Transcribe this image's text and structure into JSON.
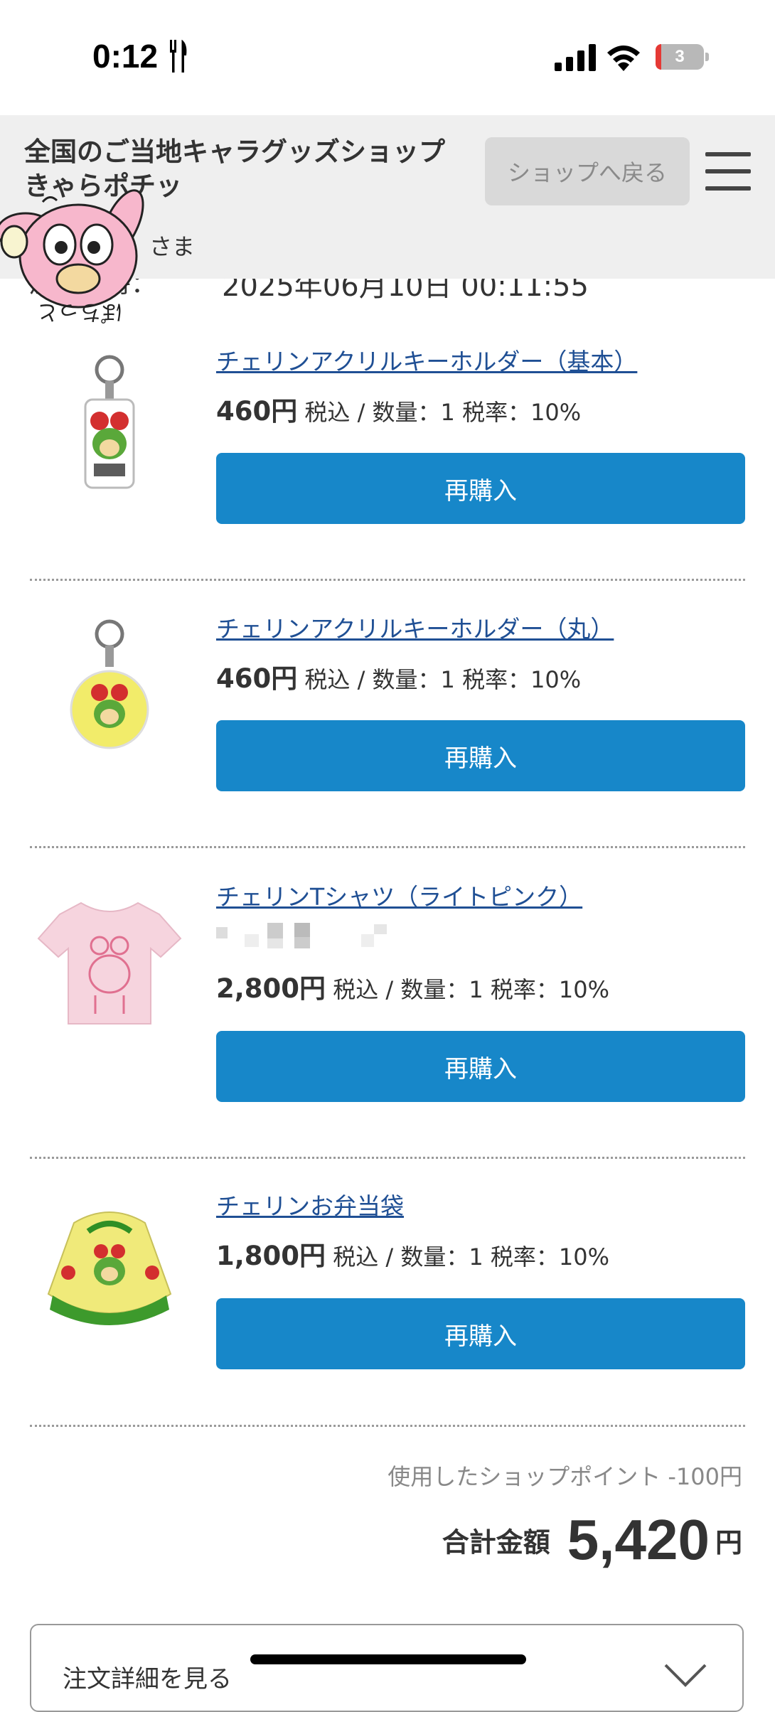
{
  "status_bar": {
    "time": "0:12",
    "battery": "3"
  },
  "header": {
    "shop_title": "全国のご当地キャラグッズショップ　きゃらポチッ",
    "back_button": "ショップへ戻る",
    "greeting": "さま"
  },
  "order": {
    "label": "注文日時：",
    "date": "2025年06月10日 00:11:55"
  },
  "mascot": {
    "caption": "ぽちっと"
  },
  "items": [
    {
      "name": "チェリンアクリルキーホルダー（基本）",
      "price": "460円",
      "meta": " 税込 / 数量：1 税率：10%",
      "rebuy": "再購入"
    },
    {
      "name": "チェリンアクリルキーホルダー（丸）",
      "price": "460円",
      "meta": " 税込 / 数量：1 税率：10%",
      "rebuy": "再購入"
    },
    {
      "name": "チェリンTシャツ（ライトピンク）",
      "price": "2,800円",
      "meta": " 税込 / 数量：1 税率：10%",
      "rebuy": "再購入"
    },
    {
      "name": "チェリンお弁当袋",
      "price": "1,800円",
      "meta": " 税込 / 数量：1 税率：10%",
      "rebuy": "再購入"
    }
  ],
  "totals": {
    "points_used": "使用したショップポイント -100円",
    "total_label": "合計金額",
    "total_value": "5,420",
    "total_unit": "円"
  },
  "details": {
    "label": "注文詳細を見る"
  }
}
